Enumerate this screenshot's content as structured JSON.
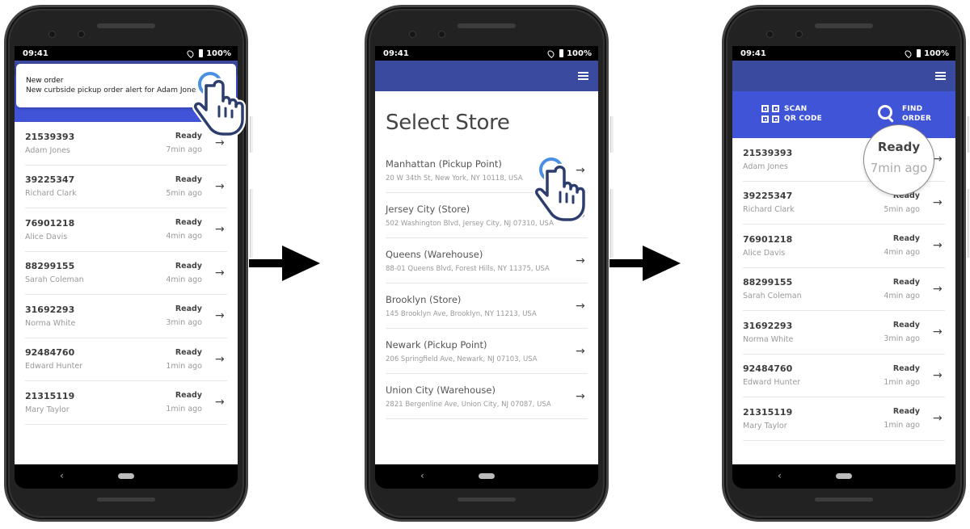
{
  "statusbar": {
    "time": "09:41",
    "battery": "100%"
  },
  "colors": {
    "header": "#3a4a9e",
    "actionbar": "#4054d8",
    "tap_ring": "#4a90e2",
    "hand_outline": "#2d3e6e"
  },
  "actions": {
    "scan_line1": "SCAN",
    "scan_line2": "QR CODE",
    "find_line1": "FIND",
    "find_line2": "ORDER"
  },
  "notification": {
    "title": "New order",
    "text": "New curbside pickup order alert for Adam Jones."
  },
  "orders": [
    {
      "id": "21539393",
      "name": "Adam Jones",
      "status": "Ready",
      "time": "7min ago"
    },
    {
      "id": "39225347",
      "name": "Richard Clark",
      "status": "Ready",
      "time": "5min ago"
    },
    {
      "id": "76901218",
      "name": "Alice Davis",
      "status": "Ready",
      "time": "4min ago"
    },
    {
      "id": "88299155",
      "name": "Sarah Coleman",
      "status": "Ready",
      "time": "4min ago"
    },
    {
      "id": "31692293",
      "name": "Norma White",
      "status": "Ready",
      "time": "3min ago"
    },
    {
      "id": "92484760",
      "name": "Edward Hunter",
      "status": "Ready",
      "time": "1min ago"
    },
    {
      "id": "21315119",
      "name": "Mary Taylor",
      "status": "Ready",
      "time": "1min ago"
    }
  ],
  "select_store": {
    "title": "Select Store",
    "stores": [
      {
        "name": "Manhattan (Pickup Point)",
        "address": "20 W 34th St, New York, NY 10118, USA"
      },
      {
        "name": "Jersey City (Store)",
        "address": "502 Washington Blvd, Jersey City, NJ 07310, USA"
      },
      {
        "name": "Queens (Warehouse)",
        "address": "88-01 Queens Blvd, Forest Hills, NY 11375, USA"
      },
      {
        "name": "Brooklyn (Store)",
        "address": "145 Brooklyn Ave, Brooklyn, NY 11213, USA"
      },
      {
        "name": "Newark (Pickup Point)",
        "address": "206 Springfield Ave, Newark, NJ 07103, USA"
      },
      {
        "name": "Union City (Warehouse)",
        "address": "2821 Bergenline Ave, Union City, NJ 07087, USA"
      }
    ]
  },
  "magnifier": {
    "status": "Ready",
    "time": "7min ago"
  },
  "icons": {
    "arrow": "→",
    "back": "‹"
  }
}
